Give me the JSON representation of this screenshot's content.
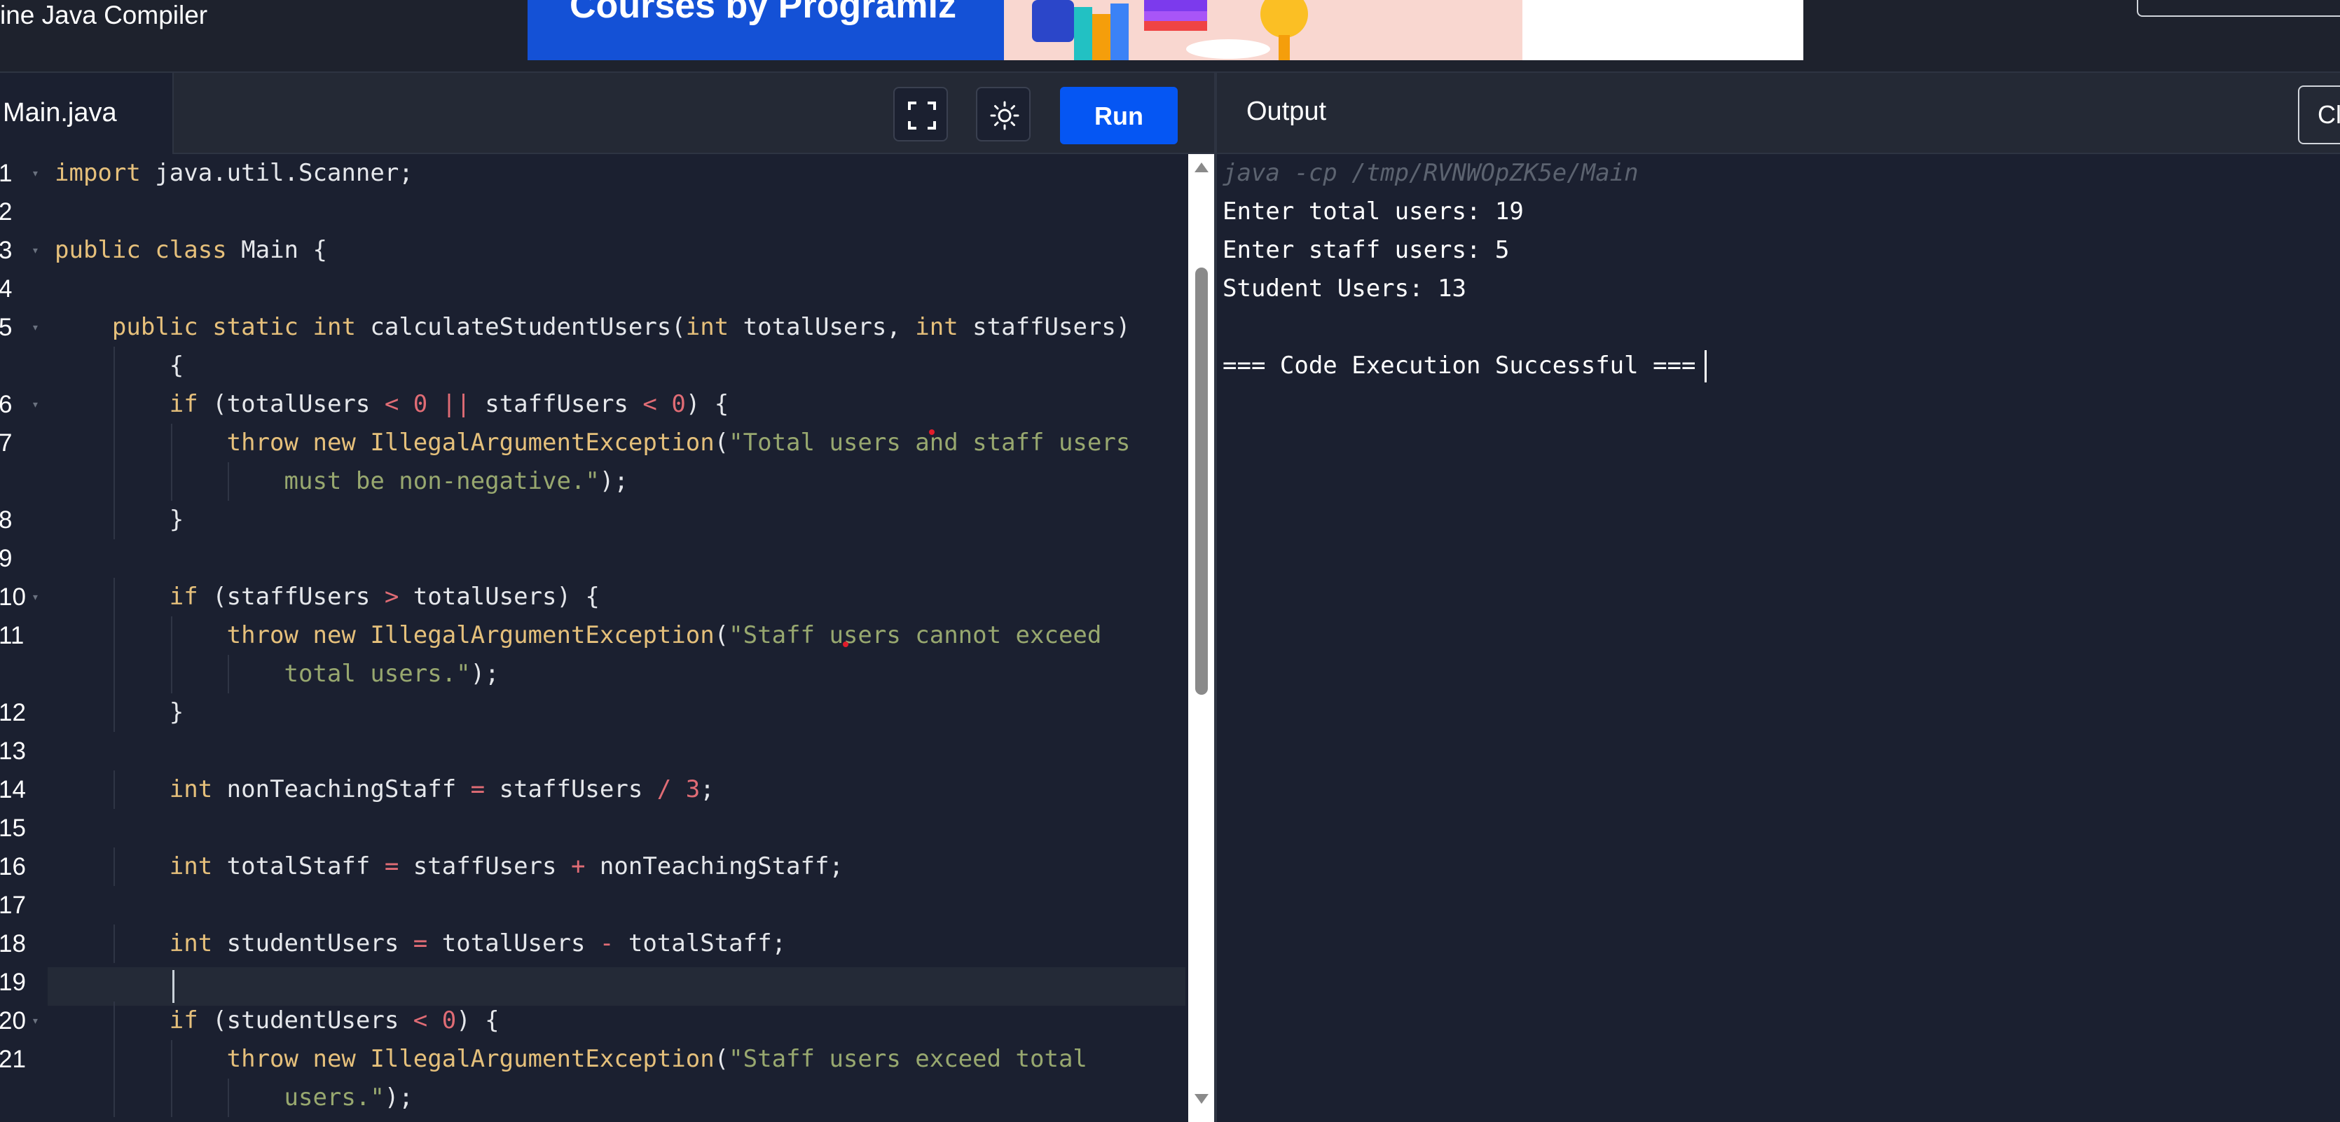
{
  "header": {
    "app_title": "ine Java Compiler",
    "ad_text": "Courses by Programiz"
  },
  "editor": {
    "file_tab": "Main.java",
    "fullscreen_icon": "fullscreen-icon",
    "theme_icon": "sun-icon",
    "run_label": "Run",
    "lines": [
      {
        "n": "1",
        "fold": true,
        "html": "<span class='kw'>import</span> java.util.Scanner;"
      },
      {
        "n": "2",
        "fold": false,
        "html": ""
      },
      {
        "n": "3",
        "fold": true,
        "html": "<span class='kw'>public</span> <span class='kw'>class</span> Main {"
      },
      {
        "n": "4",
        "fold": false,
        "html": ""
      },
      {
        "n": "5",
        "fold": true,
        "html": "    <span class='kw'>public</span> <span class='kw'>static</span> <span class='ty'>int</span> calculateStudentUsers(<span class='ty'>int</span> totalUsers, <span class='ty'>int</span> staffUsers)"
      },
      {
        "n": "",
        "fold": false,
        "html": "        {"
      },
      {
        "n": "6",
        "fold": true,
        "html": "        <span class='kw'>if</span> (totalUsers <span class='op'>&lt;</span> <span class='num'>0</span> <span class='op'>||</span> staffUsers <span class='op'>&lt;</span> <span class='num'>0</span>) {"
      },
      {
        "n": "7",
        "fold": false,
        "html": "            <span class='kw'>throw</span> <span class='kw'>new</span> <span class='cls'>IllegalArgumentException</span>(<span class='str'>\"Total users and staff users</span>"
      },
      {
        "n": "",
        "fold": false,
        "html": "                <span class='str'>must be non-negative.\"</span>);"
      },
      {
        "n": "8",
        "fold": false,
        "html": "        }"
      },
      {
        "n": "9",
        "fold": false,
        "html": ""
      },
      {
        "n": "10",
        "fold": true,
        "html": "        <span class='kw'>if</span> (staffUsers <span class='op'>&gt;</span> totalUsers) {"
      },
      {
        "n": "11",
        "fold": false,
        "html": "            <span class='kw'>throw</span> <span class='kw'>new</span> <span class='cls'>IllegalArgumentException</span>(<span class='str'>\"Staff users cannot exceed</span>"
      },
      {
        "n": "",
        "fold": false,
        "html": "                <span class='str'>total users.\"</span>);"
      },
      {
        "n": "12",
        "fold": false,
        "html": "        }"
      },
      {
        "n": "13",
        "fold": false,
        "html": ""
      },
      {
        "n": "14",
        "fold": false,
        "html": "        <span class='ty'>int</span> nonTeachingStaff <span class='op'>=</span> staffUsers <span class='op'>/</span> <span class='num'>3</span>;"
      },
      {
        "n": "15",
        "fold": false,
        "html": ""
      },
      {
        "n": "16",
        "fold": false,
        "html": "        <span class='ty'>int</span> totalStaff <span class='op'>=</span> staffUsers <span class='op'>+</span> nonTeachingStaff;"
      },
      {
        "n": "17",
        "fold": false,
        "html": ""
      },
      {
        "n": "18",
        "fold": false,
        "html": "        <span class='ty'>int</span> studentUsers <span class='op'>=</span> totalUsers <span class='op'>-</span> totalStaff;"
      },
      {
        "n": "19",
        "fold": false,
        "html": ""
      },
      {
        "n": "20",
        "fold": true,
        "html": "        <span class='kw'>if</span> (studentUsers <span class='op'>&lt;</span> <span class='num'>0</span>) {"
      },
      {
        "n": "21",
        "fold": false,
        "html": "            <span class='kw'>throw</span> <span class='kw'>new</span> <span class='cls'>IllegalArgumentException</span>(<span class='str'>\"Staff users exceed total</span>"
      },
      {
        "n": "",
        "fold": false,
        "html": "                <span class='str'>users.\"</span>);"
      }
    ]
  },
  "output": {
    "title": "Output",
    "clear_label": "Clear",
    "command": "java -cp /tmp/RVNWOpZK5e/Main",
    "lines": [
      "Enter total users: 19",
      "Enter staff users: 5",
      "Student Users: 13",
      "",
      "=== Code Execution Successful ==="
    ]
  }
}
